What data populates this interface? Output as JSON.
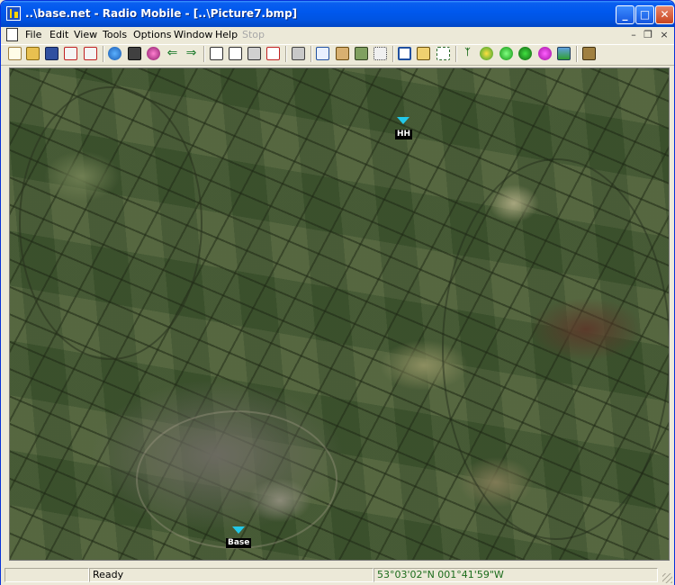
{
  "window": {
    "title": "..\\base.net - Radio Mobile - [..\\Picture7.bmp]"
  },
  "title_buttons": {
    "minimize": "_",
    "maximize": "□",
    "close": "✕"
  },
  "menu": {
    "items": [
      "File",
      "Edit",
      "View",
      "Tools",
      "Options",
      "Window",
      "Help"
    ],
    "disabled_item": "Stop"
  },
  "mdi_controls": {
    "minimize": "–",
    "restore": "❐",
    "close": "×"
  },
  "toolbar": {
    "icons": [
      "new-icon",
      "open-icon",
      "save-icon",
      "network-properties-icon",
      "unit-properties-icon",
      "world-icon",
      "disk-icon",
      "search-icon",
      "arrow-left-icon",
      "arrow-right-icon",
      "map-properties-icon",
      "map-open-icon",
      "map-save-icon",
      "map-print-icon",
      "print-icon",
      "copy-icon",
      "paste-icon",
      "merge-icon",
      "grid-icon",
      "window-icon",
      "lookup-icon",
      "fit-icon",
      "radio-link-icon",
      "polar-plot-icon",
      "coverage-icon",
      "combined-coverage-icon",
      "color-icon",
      "picture-icon",
      "exit-icon"
    ]
  },
  "map": {
    "markers": [
      {
        "label": "HH"
      },
      {
        "label": "Base"
      }
    ],
    "colors": {
      "marker": "#22c8e8",
      "label_bg": "#000000"
    }
  },
  "status": {
    "text": "Ready",
    "coordinates": "53°03'02\"N 001°41'59\"W"
  }
}
